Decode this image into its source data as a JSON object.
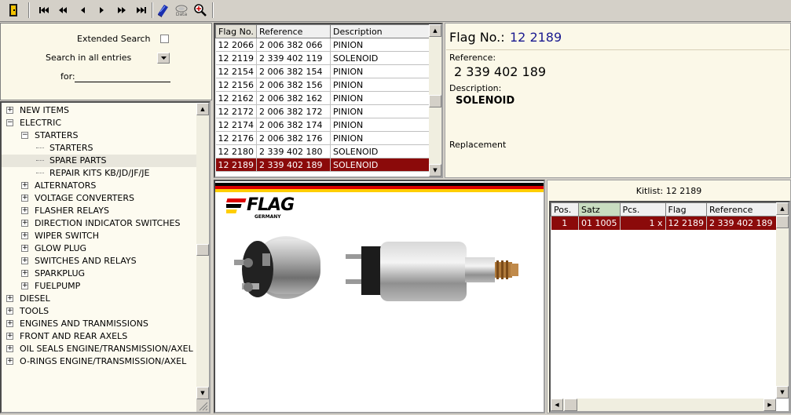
{
  "toolbar": {
    "buttons": [
      {
        "name": "exit-icon",
        "glyph": ""
      },
      {
        "name": "first-record-icon",
        "glyph": "|◀◀"
      },
      {
        "name": "previous-page-icon",
        "glyph": "◀◀"
      },
      {
        "name": "previous-record-icon",
        "glyph": "◀"
      },
      {
        "name": "next-record-icon",
        "glyph": "▶"
      },
      {
        "name": "next-page-icon",
        "glyph": "▶▶"
      },
      {
        "name": "last-record-icon",
        "glyph": "▶▶|"
      },
      {
        "name": "book-icon",
        "glyph": ""
      },
      {
        "name": "data-icon",
        "glyph": ""
      },
      {
        "name": "zoom-icon",
        "glyph": ""
      }
    ],
    "data_label": "Data"
  },
  "search": {
    "extended_label": "Extended Search",
    "scope_label": "Search in all entries",
    "for_label": "for:",
    "for_value": ""
  },
  "tree": {
    "items": [
      {
        "label": "NEW ITEMS",
        "level": 0,
        "expander": "+"
      },
      {
        "label": "ELECTRIC",
        "level": 0,
        "expander": "−"
      },
      {
        "label": "STARTERS",
        "level": 1,
        "expander": "−"
      },
      {
        "label": "STARTERS",
        "level": 2,
        "expander": ""
      },
      {
        "label": "SPARE PARTS",
        "level": 2,
        "expander": "",
        "selected": true
      },
      {
        "label": "REPAIR KITS KB/JD/JF/JE",
        "level": 2,
        "expander": ""
      },
      {
        "label": "ALTERNATORS",
        "level": 1,
        "expander": "+"
      },
      {
        "label": "VOLTAGE CONVERTERS",
        "level": 1,
        "expander": "+"
      },
      {
        "label": "FLASHER RELAYS",
        "level": 1,
        "expander": "+"
      },
      {
        "label": "DIRECTION INDICATOR SWITCHES",
        "level": 1,
        "expander": "+"
      },
      {
        "label": "WIPER SWITCH",
        "level": 1,
        "expander": "+"
      },
      {
        "label": "GLOW PLUG",
        "level": 1,
        "expander": "+"
      },
      {
        "label": "SWITCHES AND RELAYS",
        "level": 1,
        "expander": "+"
      },
      {
        "label": "SPARKPLUG",
        "level": 1,
        "expander": "+"
      },
      {
        "label": "FUELPUMP",
        "level": 1,
        "expander": "+"
      },
      {
        "label": "DIESEL",
        "level": 0,
        "expander": "+"
      },
      {
        "label": "TOOLS",
        "level": 0,
        "expander": "+"
      },
      {
        "label": "ENGINES AND TRANMISSIONS",
        "level": 0,
        "expander": "+"
      },
      {
        "label": "FRONT AND REAR AXELS",
        "level": 0,
        "expander": "+"
      },
      {
        "label": "OIL SEALS  ENGINE/TRANSMISSION/AXEL",
        "level": 0,
        "expander": "+"
      },
      {
        "label": "O-RINGS ENGINE/TRANSMISSION/AXEL",
        "level": 0,
        "expander": "+"
      }
    ]
  },
  "grid": {
    "headers": [
      "Flag No.",
      "Reference",
      "Description"
    ],
    "rows": [
      [
        "12 2066",
        "2 006 382 066",
        "PINION"
      ],
      [
        "12 2119",
        "2 339 402 119",
        "SOLENOID"
      ],
      [
        "12 2154",
        "2 006 382 154",
        "PINION"
      ],
      [
        "12 2156",
        "2 006 382 156",
        "PINION"
      ],
      [
        "12 2162",
        "2 006 382 162",
        "PINION"
      ],
      [
        "12 2172",
        "2 006 382 172",
        "PINION"
      ],
      [
        "12 2174",
        "2 006 382 174",
        "PINION"
      ],
      [
        "12 2176",
        "2 006 382 176",
        "PINION"
      ],
      [
        "12 2180",
        "2 339 402 180",
        "SOLENOID"
      ],
      [
        "12 2189",
        "2 339 402 189",
        "SOLENOID"
      ]
    ],
    "selected_index": 9
  },
  "detail": {
    "flag_label": "Flag No.:",
    "flag_value": "12 2189",
    "reference_label": "Reference:",
    "reference_value": "2 339 402 189",
    "description_label": "Description:",
    "description_value": "SOLENOID",
    "replacement_label": "Replacement"
  },
  "image": {
    "logo_text": "FLAG",
    "logo_sub": "GERMANY",
    "flag_colors": [
      "#000000",
      "#dd0000",
      "#ffce00"
    ]
  },
  "kitlist": {
    "title": "Kitlist: 12 2189",
    "headers": [
      "Pos.",
      "Satz",
      "Pcs.",
      "Flag",
      "Reference"
    ],
    "rows": [
      [
        "1",
        "01 1005",
        "1 x",
        "12 2189",
        "2 339 402 189"
      ]
    ]
  },
  "colors": {
    "selection": "#8b0a0a",
    "panel": "#fbf8e8"
  }
}
